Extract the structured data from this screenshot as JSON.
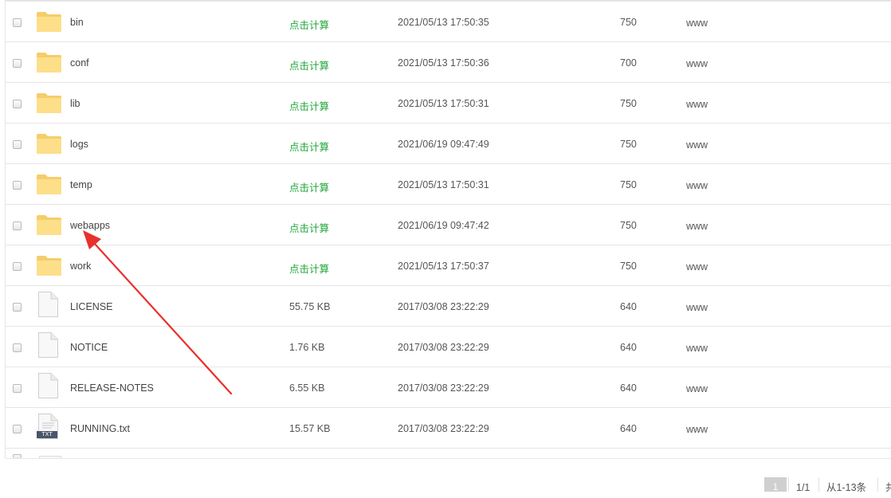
{
  "files": [
    {
      "name": "bin",
      "type": "folder",
      "size": "点击计算",
      "mtime": "2021/05/13 17:50:35",
      "perm": "750",
      "owner": "www"
    },
    {
      "name": "conf",
      "type": "folder",
      "size": "点击计算",
      "mtime": "2021/05/13 17:50:36",
      "perm": "700",
      "owner": "www"
    },
    {
      "name": "lib",
      "type": "folder",
      "size": "点击计算",
      "mtime": "2021/05/13 17:50:31",
      "perm": "750",
      "owner": "www"
    },
    {
      "name": "logs",
      "type": "folder",
      "size": "点击计算",
      "mtime": "2021/06/19 09:47:49",
      "perm": "750",
      "owner": "www"
    },
    {
      "name": "temp",
      "type": "folder",
      "size": "点击计算",
      "mtime": "2021/05/13 17:50:31",
      "perm": "750",
      "owner": "www"
    },
    {
      "name": "webapps",
      "type": "folder",
      "size": "点击计算",
      "mtime": "2021/06/19 09:47:42",
      "perm": "750",
      "owner": "www"
    },
    {
      "name": "work",
      "type": "folder",
      "size": "点击计算",
      "mtime": "2021/05/13 17:50:37",
      "perm": "750",
      "owner": "www"
    },
    {
      "name": "LICENSE",
      "type": "file",
      "size": "55.75 KB",
      "mtime": "2017/03/08 23:22:29",
      "perm": "640",
      "owner": "www"
    },
    {
      "name": "NOTICE",
      "type": "file",
      "size": "1.76 KB",
      "mtime": "2017/03/08 23:22:29",
      "perm": "640",
      "owner": "www"
    },
    {
      "name": "RELEASE-NOTES",
      "type": "file",
      "size": "6.55 KB",
      "mtime": "2017/03/08 23:22:29",
      "perm": "640",
      "owner": "www"
    },
    {
      "name": "RUNNING.txt",
      "type": "txt",
      "icon_label": "TXT",
      "size": "15.57 KB",
      "mtime": "2017/03/08 23:22:29",
      "perm": "640",
      "owner": "www"
    }
  ],
  "pagination": {
    "current_page": "1",
    "page_of": "1/1",
    "range": "从1-13条",
    "total_partial": "共"
  },
  "icons": {
    "folder": "folder-icon",
    "file": "file-icon",
    "txt": "txt-file-icon",
    "checkbox": "checkbox"
  },
  "colors": {
    "calc_link": "#20a53a",
    "folder_fill": "#fddf8a",
    "annotation_arrow": "#e8302c"
  }
}
